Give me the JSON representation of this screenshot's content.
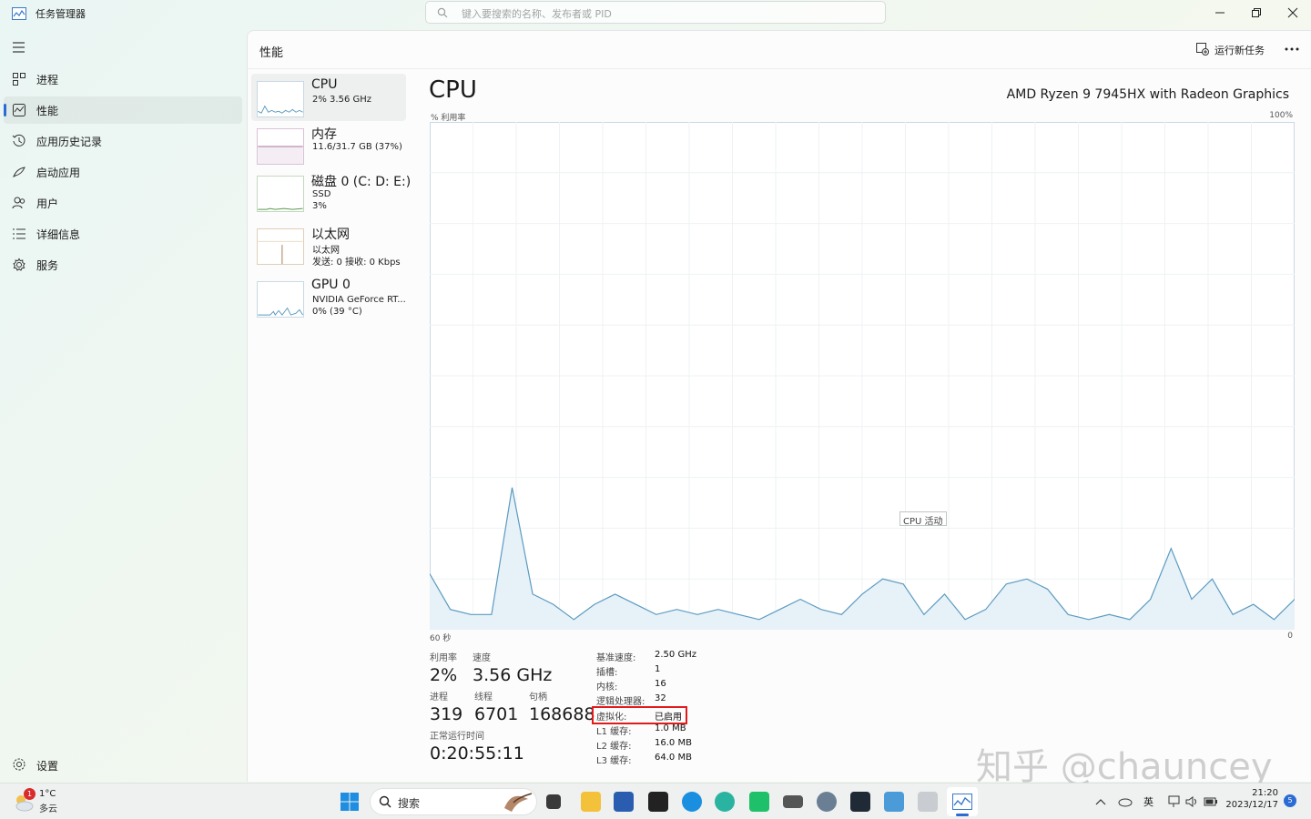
{
  "window": {
    "title": "任务管理器",
    "search_placeholder": "键入要搜索的名称、发布者或 PID"
  },
  "nav": {
    "items": [
      {
        "label": "进程",
        "icon": "processes-icon"
      },
      {
        "label": "性能",
        "icon": "performance-icon",
        "active": true
      },
      {
        "label": "应用历史记录",
        "icon": "app-history-icon"
      },
      {
        "label": "启动应用",
        "icon": "startup-icon"
      },
      {
        "label": "用户",
        "icon": "users-icon"
      },
      {
        "label": "详细信息",
        "icon": "details-icon"
      },
      {
        "label": "服务",
        "icon": "services-icon"
      }
    ],
    "settings_label": "设置"
  },
  "header": {
    "title": "性能",
    "run_task_label": "运行新任务"
  },
  "perf_list": [
    {
      "name": "CPU",
      "lines": [
        "2%  3.56 GHz"
      ],
      "active": true
    },
    {
      "name": "内存",
      "lines": [
        "11.6/31.7 GB (37%)"
      ]
    },
    {
      "name": "磁盘 0 (C: D: E:)",
      "lines": [
        "SSD",
        "3%"
      ]
    },
    {
      "name": "以太网",
      "lines": [
        "以太网",
        "发送: 0  接收: 0 Kbps"
      ]
    },
    {
      "name": "GPU 0",
      "lines": [
        "NVIDIA GeForce RT...",
        "0%  (39 °C)"
      ]
    }
  ],
  "cpu": {
    "title": "CPU",
    "model": "AMD Ryzen 9 7945HX with Radeon Graphics",
    "util_label": "% 利用率",
    "util_max": "100%",
    "time_left": "60 秒",
    "time_right": "0",
    "tooltip": "CPU 活动",
    "stats": {
      "utilization": {
        "label": "利用率",
        "value": "2%"
      },
      "speed": {
        "label": "速度",
        "value": "3.56 GHz"
      },
      "processes": {
        "label": "进程",
        "value": "319"
      },
      "threads": {
        "label": "线程",
        "value": "6701"
      },
      "handles": {
        "label": "句柄",
        "value": "168688"
      },
      "uptime": {
        "label": "正常运行时间",
        "value": "0:20:55:11"
      }
    },
    "specs": [
      {
        "key": "基准速度:",
        "value": "2.50 GHz"
      },
      {
        "key": "插槽:",
        "value": "1"
      },
      {
        "key": "内核:",
        "value": "16"
      },
      {
        "key": "逻辑处理器:",
        "value": "32"
      },
      {
        "key": "虚拟化:",
        "value": "已启用",
        "highlighted": true
      },
      {
        "key": "L1 缓存:",
        "value": "1.0 MB"
      },
      {
        "key": "L2 缓存:",
        "value": "16.0 MB"
      },
      {
        "key": "L3 缓存:",
        "value": "64.0 MB"
      }
    ],
    "history_percent": [
      11,
      4,
      3,
      3,
      28,
      7,
      5,
      2,
      5,
      7,
      5,
      3,
      4,
      3,
      4,
      3,
      2,
      4,
      6,
      4,
      3,
      7,
      10,
      9,
      3,
      7,
      2,
      4,
      9,
      10,
      8,
      3,
      2,
      3,
      2,
      6,
      16,
      6,
      10,
      3,
      5,
      2,
      6
    ]
  },
  "watermark": "知乎 @chauncey",
  "taskbar": {
    "weather_temp": "1°C",
    "weather_cond": "多云",
    "weather_badge": "1",
    "search_label": "搜索",
    "ime": "英",
    "time": "21:20",
    "date": "2023/12/17",
    "notif_count": "5"
  },
  "colors": {
    "accent": "#2a6bd4",
    "cpu_line": "#5b9bc0",
    "cpu_fill": "#e7f1f8",
    "highlight": "#e01b1b"
  }
}
